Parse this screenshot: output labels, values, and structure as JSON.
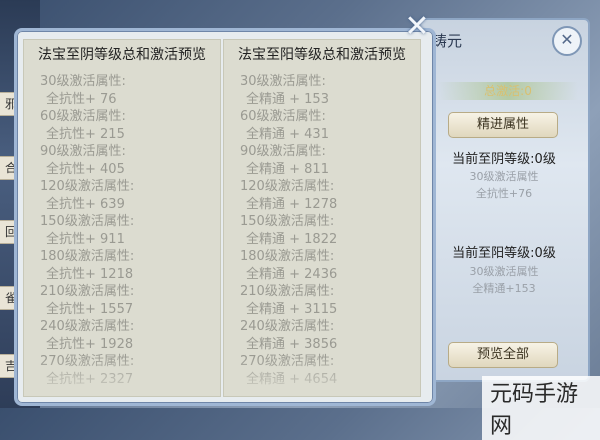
{
  "background": {
    "left_tabs": [
      "邪",
      "合",
      "回",
      "雀",
      "吉"
    ]
  },
  "base_window": {
    "title": "铸元",
    "close_icon": "close-icon",
    "stat_label": "总激活:0",
    "refine_button": "精进属性",
    "yin": {
      "title": "当前至阴等级:0级",
      "line1": "30级激活属性",
      "line2": "全抗性+76"
    },
    "yang": {
      "title": "当前至阳等级:0级",
      "line1": "30级激活属性",
      "line2": "全精通+153"
    },
    "preview_all_button": "预览全部"
  },
  "popup": {
    "close_icon": "close-icon",
    "left": {
      "header": "法宝至阴等级总和激活预览",
      "rows": [
        {
          "label": "30级激活属性:",
          "value": "全抗性+ 76"
        },
        {
          "label": "60级激活属性:",
          "value": "全抗性+ 215"
        },
        {
          "label": "90级激活属性:",
          "value": "全抗性+ 405"
        },
        {
          "label": "120级激活属性:",
          "value": "全抗性+ 639"
        },
        {
          "label": "150级激活属性:",
          "value": "全抗性+ 911"
        },
        {
          "label": "180级激活属性:",
          "value": "全抗性+ 1218"
        },
        {
          "label": "210级激活属性:",
          "value": "全抗性+ 1557"
        },
        {
          "label": "240级激活属性:",
          "value": "全抗性+ 1928"
        },
        {
          "label": "270级激活属性:",
          "value": "全抗性+ 2327"
        }
      ]
    },
    "right": {
      "header": "法宝至阳等级总和激活预览",
      "rows": [
        {
          "label": "30级激活属性:",
          "value": "全精通 + 153"
        },
        {
          "label": "60级激活属性:",
          "value": "全精通 + 431"
        },
        {
          "label": "90级激活属性:",
          "value": "全精通 + 811"
        },
        {
          "label": "120级激活属性:",
          "value": "全精通 + 1278"
        },
        {
          "label": "150级激活属性:",
          "value": "全精通 + 1822"
        },
        {
          "label": "180级激活属性:",
          "value": "全精通 + 2436"
        },
        {
          "label": "210级激活属性:",
          "value": "全精通 + 3115"
        },
        {
          "label": "240级激活属性:",
          "value": "全精通 + 3856"
        },
        {
          "label": "270级激活属性:",
          "value": "全精通 + 4654"
        }
      ]
    }
  },
  "watermark": "元码手游网"
}
